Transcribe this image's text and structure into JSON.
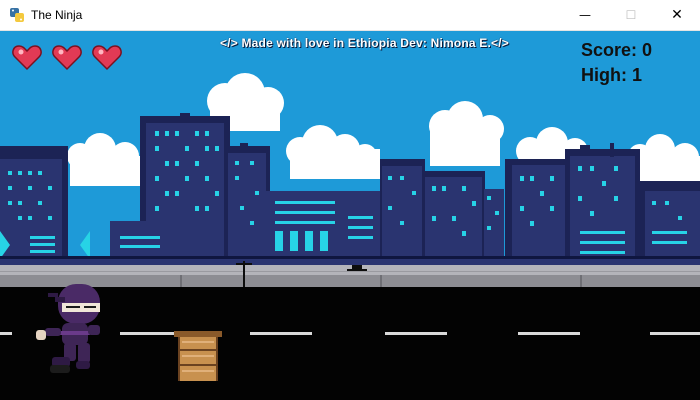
{
  "window": {
    "title": "The Ninja",
    "icons": {
      "app": "python-icon",
      "minimize": "minimize-icon",
      "maximize": "maximize-icon",
      "close": "close-icon"
    },
    "minimize_glyph": "—",
    "maximize_glyph": "☐",
    "close_glyph": "✕"
  },
  "hud": {
    "credit": "</> Made with love in Ethiopia Dev: Nimona E.</>",
    "score_label": "Score: 0",
    "high_label": "High: 1",
    "lives": 3,
    "heart_icon": "heart-icon"
  },
  "colors": {
    "sky": "#1e9ad8",
    "cloud": "#ffffff",
    "building": "#2a3470",
    "building_dark": "#1c2355",
    "window_lit": "#27d3e6",
    "road": "#030303",
    "sidewalk": "#8d8d93",
    "lane": "#d9d9d9",
    "heart": "#e23a55",
    "ninja": "#4a2a66",
    "crate": "#c8914f"
  }
}
